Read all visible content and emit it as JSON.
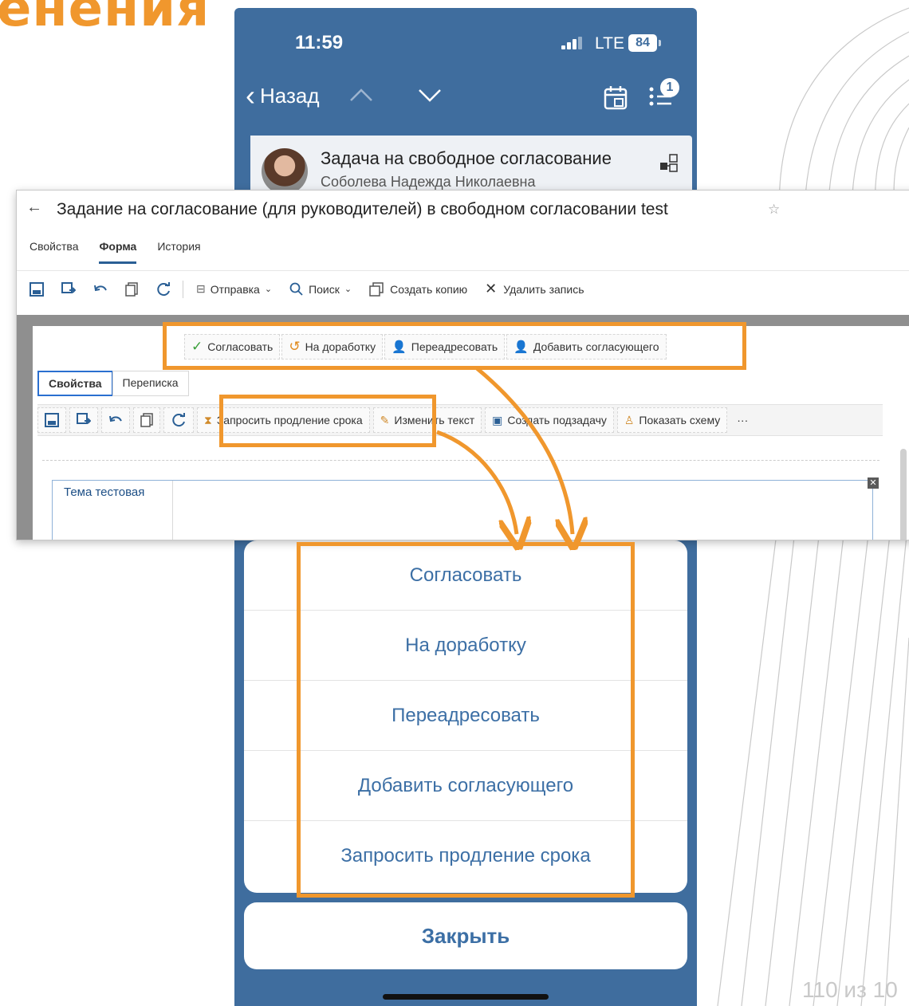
{
  "slide": {
    "title_fragment": "енения",
    "page_counter": "110 из 10"
  },
  "phone": {
    "status_time": "11:59",
    "network": "LTE",
    "battery": "84",
    "back_label": "Назад",
    "notification_count": "1",
    "task_title": "Задача на свободное согласование",
    "task_author": "Соболева Надежда Николаевна",
    "actions": [
      "Согласовать",
      "На доработку",
      "Переадресовать",
      "Добавить согласующего",
      "Запросить продление срока"
    ],
    "close_label": "Закрыть"
  },
  "window": {
    "title": "Задание на согласование (для руководителей) в свободном согласовании test",
    "tabs": [
      "Свойства",
      "Форма",
      "История"
    ],
    "active_tab": "Форма",
    "toolbar": {
      "send": "Отправка",
      "search": "Поиск",
      "copy": "Создать копию",
      "delete": "Удалить запись"
    },
    "form": {
      "actions": [
        "Согласовать",
        "На доработку",
        "Переадресовать",
        "Добавить согласующего"
      ],
      "tabs": [
        "Свойства",
        "Переписка"
      ],
      "toolbar": {
        "extend": "Запросить продление срока",
        "edit_text": "Изменить текст",
        "create_subtask": "Создать подзадачу",
        "show_scheme": "Показать схему",
        "more": "···"
      },
      "field_label": "Тема тестовая"
    }
  },
  "colors": {
    "accent_orange": "#f0972d",
    "phone_blue": "#3f6d9e",
    "link_blue": "#3c6fa5"
  }
}
